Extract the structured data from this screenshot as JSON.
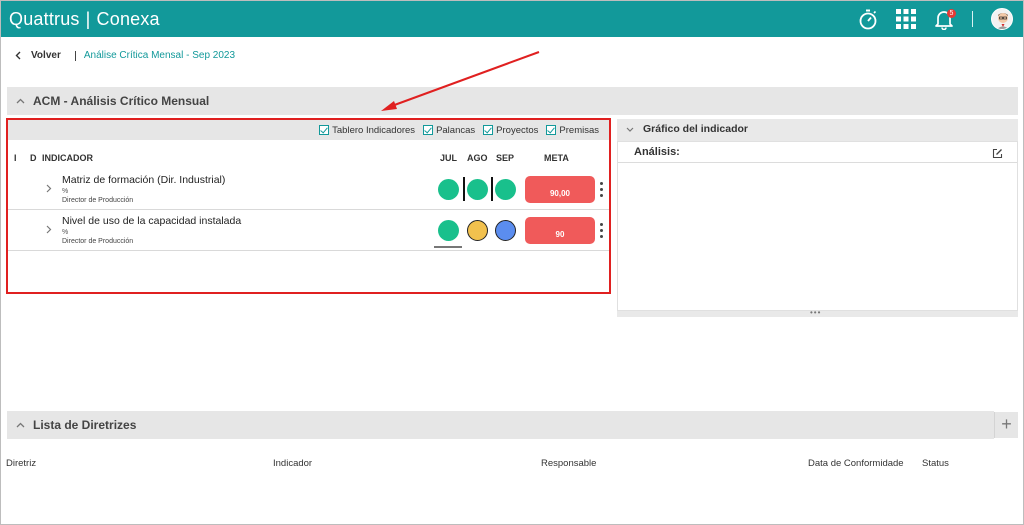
{
  "app": {
    "brand_left": "Quattrus",
    "brand_right": "Conexa",
    "notification_count": "5"
  },
  "breadcrumb": {
    "back_label": "Volver",
    "current": "Análise Crítica Mensal - Sep 2023"
  },
  "section_acm": {
    "title": "ACM - Análisis Crítico Mensual"
  },
  "filters": [
    "Tablero Indicadores",
    "Palancas",
    "Proyectos",
    "Premisas"
  ],
  "grid": {
    "headers": {
      "i": "I",
      "d": "D",
      "indicator": "INDICADOR",
      "jul": "JUL",
      "ago": "AGO",
      "sep": "SEP",
      "meta": "META"
    },
    "rows": [
      {
        "name": "Matriz de formación (Dir. Industrial)",
        "unit": "%",
        "owner": "Director de Producción",
        "status": [
          "green",
          "green",
          "green"
        ],
        "meta": "90,00"
      },
      {
        "name": "Nivel de uso de la capacidad instalada",
        "unit": "%",
        "owner": "Director de Producción",
        "status": [
          "green",
          "yellow",
          "blue"
        ],
        "meta": "90"
      }
    ]
  },
  "chart_panel": {
    "title": "Gráfico del indicador",
    "analysis_label": "Análisis:"
  },
  "section_guidelines": {
    "title": "Lista de Diretrizes",
    "columns": [
      "Diretriz",
      "Indicador",
      "Responsable",
      "Data de Conformidade",
      "Status"
    ]
  },
  "colors": {
    "brand": "#12999a",
    "green": "#19c08c",
    "yellow": "#f2c14e",
    "blue": "#5b8def",
    "meta_red": "#f05a5a",
    "annotation_red": "#e02020"
  }
}
